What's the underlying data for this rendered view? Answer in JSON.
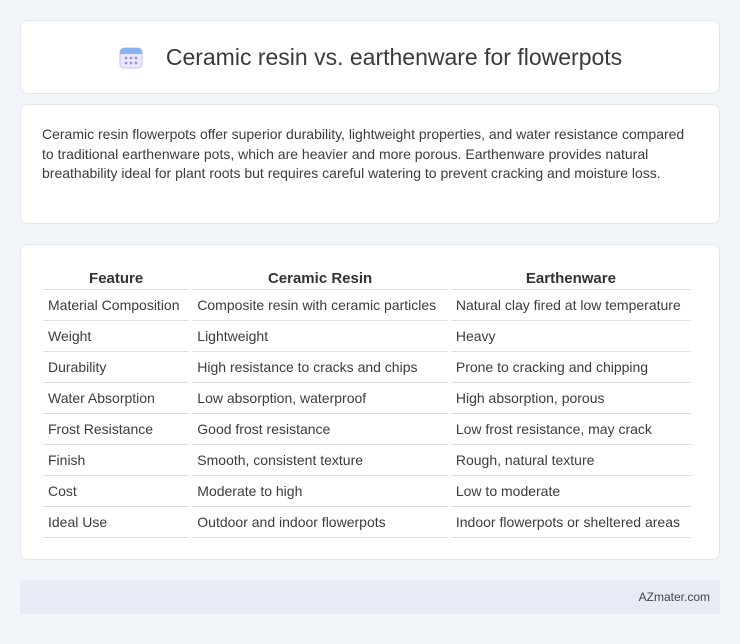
{
  "header": {
    "title": "Ceramic resin vs. earthenware for flowerpots",
    "icon": "calendar-icon",
    "icon_color": "#8b7fe0"
  },
  "summary": {
    "text": "Ceramic resin flowerpots offer superior durability, lightweight properties, and water resistance compared to traditional earthenware pots, which are heavier and more porous. Earthenware provides natural breathability ideal for plant roots but requires careful watering to prevent cracking and moisture loss."
  },
  "table": {
    "headers": [
      "Feature",
      "Ceramic Resin",
      "Earthenware"
    ],
    "rows": [
      [
        "Material Composition",
        "Composite resin with ceramic particles",
        "Natural clay fired at low temperature"
      ],
      [
        "Weight",
        "Lightweight",
        "Heavy"
      ],
      [
        "Durability",
        "High resistance to cracks and chips",
        "Prone to cracking and chipping"
      ],
      [
        "Water Absorption",
        "Low absorption, waterproof",
        "High absorption, porous"
      ],
      [
        "Frost Resistance",
        "Good frost resistance",
        "Low frost resistance, may crack"
      ],
      [
        "Finish",
        "Smooth, consistent texture",
        "Rough, natural texture"
      ],
      [
        "Cost",
        "Moderate to high",
        "Low to moderate"
      ],
      [
        "Ideal Use",
        "Outdoor and indoor flowerpots",
        "Indoor flowerpots or sheltered areas"
      ]
    ]
  },
  "footer": {
    "brand": "AZmater.com"
  }
}
